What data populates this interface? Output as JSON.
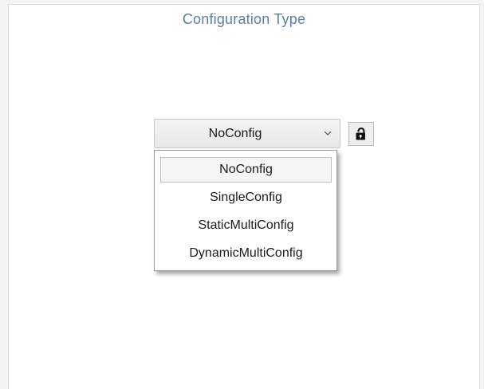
{
  "page": {
    "title": "Configuration Type"
  },
  "config_select": {
    "value": "NoConfig",
    "arrow_icon": "chevron-down-icon",
    "options": [
      {
        "label": "NoConfig",
        "selected": true
      },
      {
        "label": "SingleConfig",
        "selected": false
      },
      {
        "label": "StaticMultiConfig",
        "selected": false
      },
      {
        "label": "DynamicMultiConfig",
        "selected": false
      }
    ]
  },
  "lock_button": {
    "icon": "unlocked-padlock-icon",
    "state": "unlocked"
  },
  "colors": {
    "title": "#5b7fa6",
    "panel_background": "#ffffff",
    "outer_background": "#f3f3f3"
  }
}
